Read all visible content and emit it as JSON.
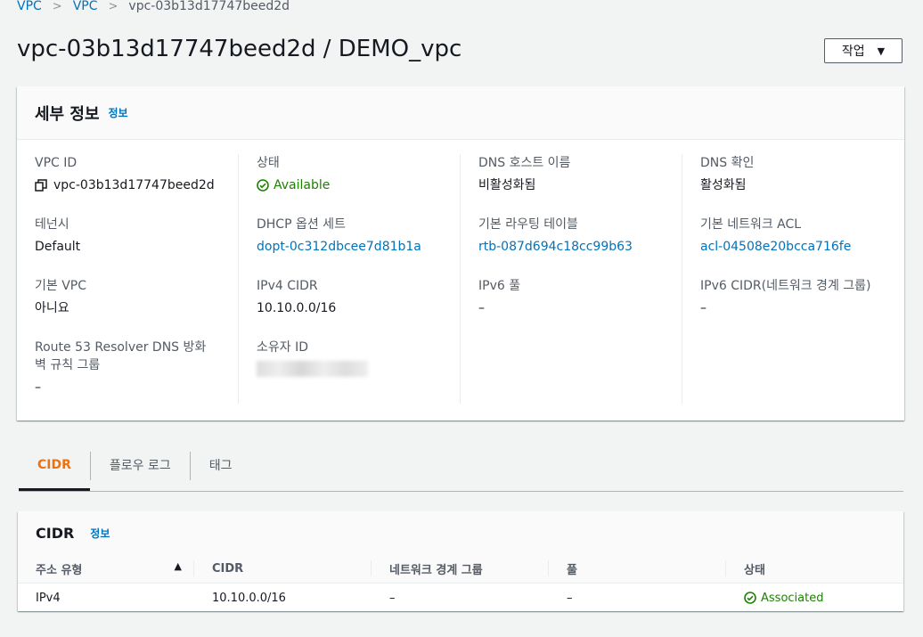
{
  "breadcrumb": {
    "items": [
      "VPC",
      "VPC"
    ],
    "current": "vpc-03b13d17747beed2d"
  },
  "page": {
    "title": "vpc-03b13d17747beed2d / DEMO_vpc",
    "actions_label": "작업"
  },
  "details": {
    "header": "세부 정보",
    "info": "정보",
    "vpc_id_label": "VPC ID",
    "vpc_id_value": "vpc-03b13d17747beed2d",
    "tenancy_label": "테넌시",
    "tenancy_value": "Default",
    "default_vpc_label": "기본 VPC",
    "default_vpc_value": "아니요",
    "route53_label": "Route 53 Resolver DNS 방화벽 규칙 그룹",
    "route53_value": "–",
    "state_label": "상태",
    "state_value": "Available",
    "dhcp_label": "DHCP 옵션 세트",
    "dhcp_value": "dopt-0c312dbcee7d81b1a",
    "ipv4_label": "IPv4 CIDR",
    "ipv4_value": "10.10.0.0/16",
    "owner_label": "소유자 ID",
    "dns_hostname_label": "DNS 호스트 이름",
    "dns_hostname_value": "비활성화됨",
    "main_rt_label": "기본 라우팅 테이블",
    "main_rt_value": "rtb-087d694c18cc99b63",
    "ipv6_pool_label": "IPv6 풀",
    "ipv6_pool_value": "–",
    "dns_res_label": "DNS 확인",
    "dns_res_value": "활성화됨",
    "main_acl_label": "기본 네트워크 ACL",
    "main_acl_value": "acl-04508e20bcca716fe",
    "ipv6_cidr_label": "IPv6 CIDR(네트워크 경계 그룹)",
    "ipv6_cidr_value": "–"
  },
  "tabs": [
    "CIDR",
    "플로우 로그",
    "태그"
  ],
  "cidr": {
    "header": "CIDR",
    "info": "정보",
    "columns": [
      "주소 유형",
      "CIDR",
      "네트워크 경계 그룹",
      "풀",
      "상태"
    ],
    "rows": [
      {
        "type": "IPv4",
        "cidr": "10.10.0.0/16",
        "group": "–",
        "pool": "–",
        "status": "Associated"
      }
    ]
  },
  "colors": {
    "link": "#0073bb",
    "success": "#1d8102",
    "active_tab": "#ec7211"
  }
}
